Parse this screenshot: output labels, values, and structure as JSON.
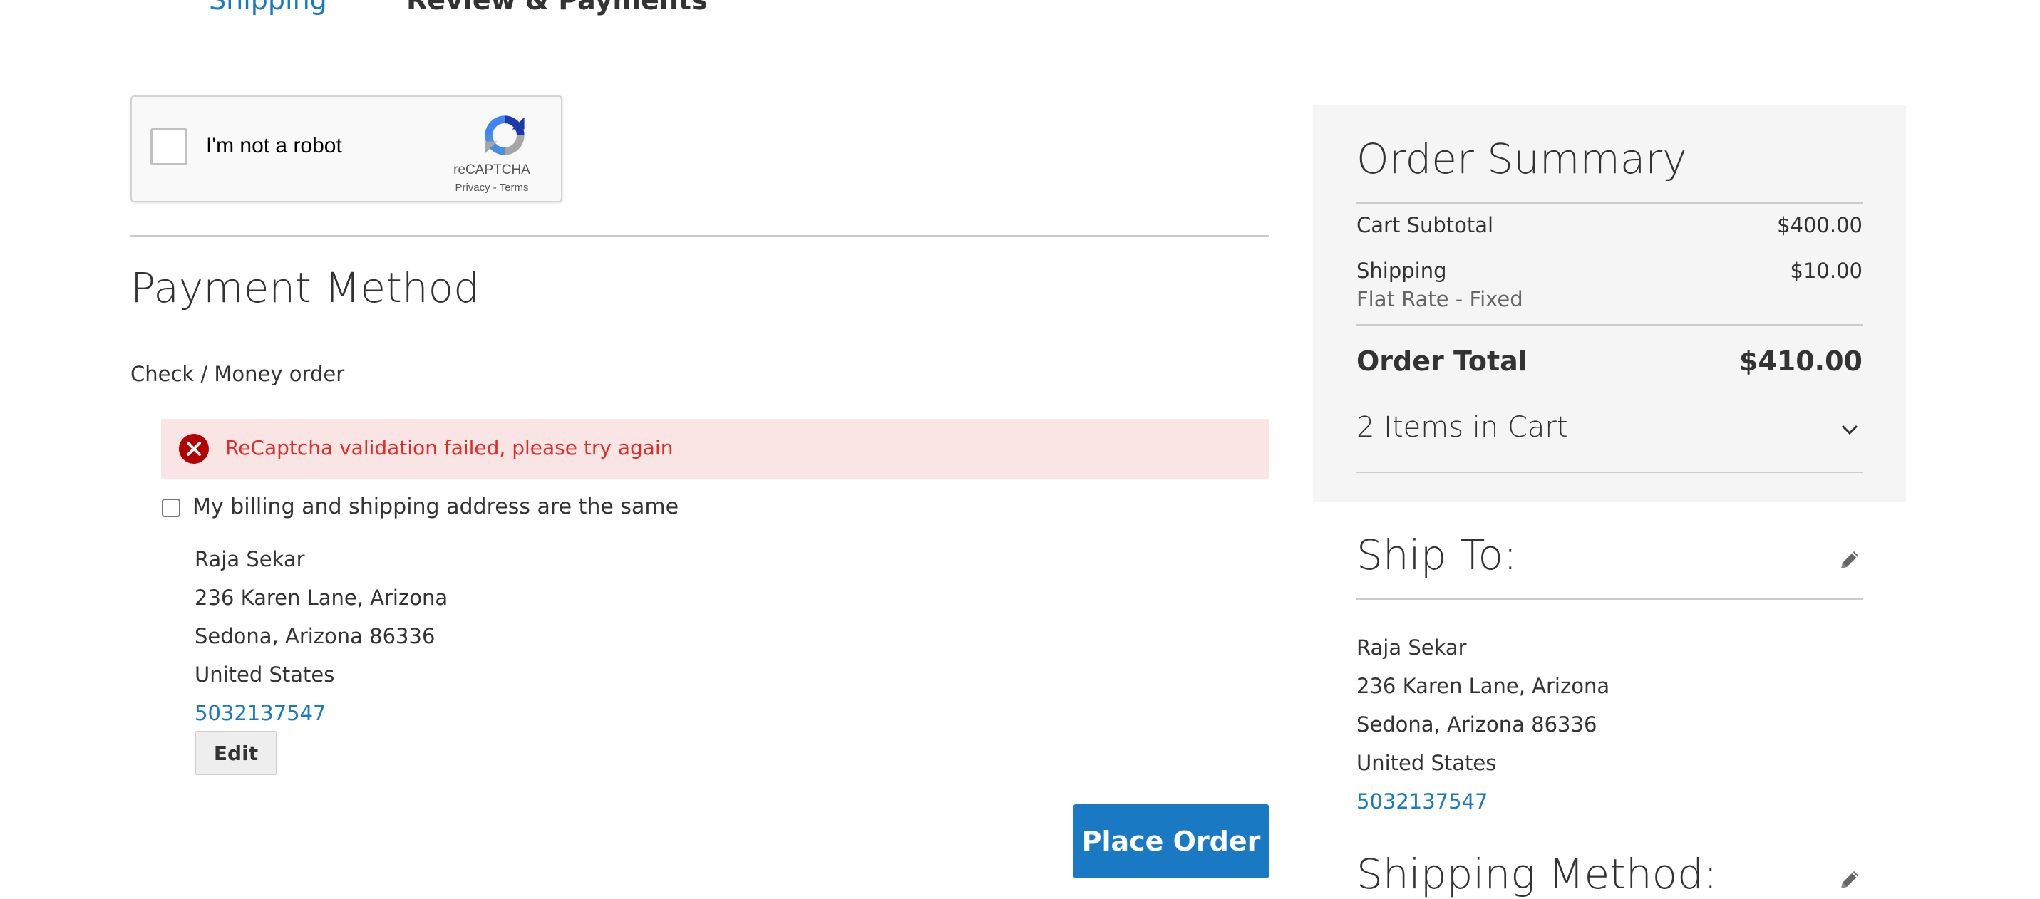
{
  "progress": {
    "steps": [
      {
        "label": "Shipping"
      },
      {
        "label": "Review & Payments"
      }
    ]
  },
  "recaptcha": {
    "label": "I'm not a robot",
    "brand": "reCAPTCHA",
    "links": "Privacy - Terms"
  },
  "payment": {
    "title": "Payment Method",
    "method_name": "Check / Money order",
    "error_message": "ReCaptcha validation failed, please try again",
    "same_address_label": "My billing and shipping address are the same",
    "same_address_checked": false,
    "billing_address": {
      "name": "Raja Sekar",
      "street": "236 Karen Lane, Arizona",
      "city_line": "Sedona, Arizona 86336",
      "country": "United States",
      "phone": "5032137547"
    },
    "edit_label": "Edit",
    "place_order_label": "Place Order"
  },
  "summary": {
    "title": "Order Summary",
    "cart_subtotal_label": "Cart Subtotal",
    "cart_subtotal_value": "$400.00",
    "shipping_label": "Shipping",
    "shipping_value": "$10.00",
    "shipping_method": "Flat Rate - Fixed",
    "order_total_label": "Order Total",
    "order_total_value": "$410.00",
    "items_label": "2 Items in Cart"
  },
  "ship_to": {
    "title": "Ship To:",
    "address": {
      "name": "Raja Sekar",
      "street": "236 Karen Lane, Arizona",
      "city_line": "Sedona, Arizona 86336",
      "country": "United States",
      "phone": "5032137547"
    }
  },
  "shipping_method": {
    "title": "Shipping Method:"
  },
  "colors": {
    "link": "#1979c3",
    "primary_button": "#1979c3",
    "error_text": "#e02b27",
    "error_background": "#fae5e5",
    "summary_background": "#f5f5f5"
  },
  "icons": {
    "recaptcha": "recaptcha-logo-icon",
    "error": "error-circle-icon",
    "chevron": "chevron-down-icon",
    "edit": "pencil-icon"
  }
}
